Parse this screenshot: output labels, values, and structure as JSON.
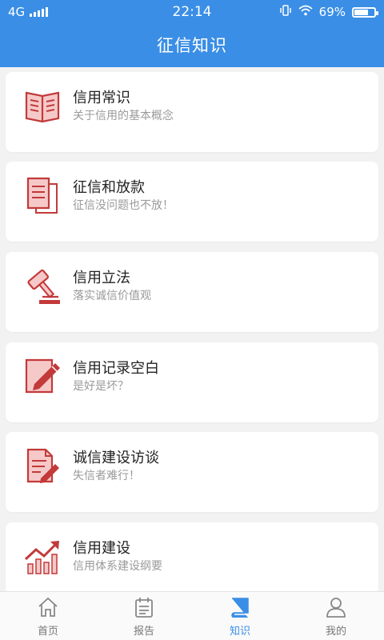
{
  "status": {
    "network": "4G",
    "time": "22:14",
    "battery": "69%",
    "battery_level": 0.69
  },
  "header": {
    "title": "征信知识"
  },
  "colors": {
    "primary": "#3a8ee6",
    "icon_red": "#c23a3a",
    "icon_fill": "#f6c9c9"
  },
  "items": [
    {
      "title": "信用常识",
      "subtitle": "关于信用的基本概念",
      "icon": "open-book-icon"
    },
    {
      "title": "征信和放款",
      "subtitle": "征信没问题也不放！",
      "icon": "document-copy-icon"
    },
    {
      "title": "信用立法",
      "subtitle": "落实诚信价值观",
      "icon": "gavel-icon"
    },
    {
      "title": "信用记录空白",
      "subtitle": "是好是坏？",
      "icon": "edit-pencil-icon"
    },
    {
      "title": "诚信建设访谈",
      "subtitle": "失信者难行！",
      "icon": "document-pen-icon"
    },
    {
      "title": "信用建设",
      "subtitle": "信用体系建设纲要",
      "icon": "growth-chart-icon"
    }
  ],
  "tabs": [
    {
      "label": "首页",
      "icon": "home-icon",
      "active": false
    },
    {
      "label": "报告",
      "icon": "report-icon",
      "active": false
    },
    {
      "label": "知识",
      "icon": "book-icon",
      "active": true
    },
    {
      "label": "我的",
      "icon": "user-icon",
      "active": false
    }
  ]
}
